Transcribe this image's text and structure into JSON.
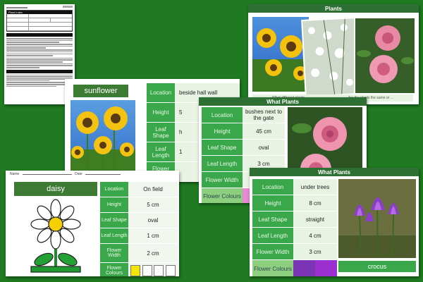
{
  "doc": {
    "heading": "Plant Index"
  },
  "sunflower_card": {
    "title": "sunflower",
    "rows": [
      {
        "label": "Location",
        "value": "beside hall wall"
      },
      {
        "label": "Height",
        "value": "5"
      },
      {
        "label": "Leaf Shape",
        "value": "h"
      },
      {
        "label": "Leaf Length",
        "value": "1"
      },
      {
        "label": "Flower Width",
        "value": ""
      }
    ],
    "colours": [
      "#f6c800",
      "#ffffff"
    ]
  },
  "plants_card": {
    "header": "Plants",
    "footer_left": "What different plants ...",
    "footer_right": "Are the plants the same or ..."
  },
  "what_plants_1": {
    "header": "What Plants",
    "rows": [
      {
        "label": "Location",
        "value": "bushes next to the gate"
      },
      {
        "label": "Height",
        "value": "45 cm"
      },
      {
        "label": "Leaf Shape",
        "value": "oval"
      },
      {
        "label": "Leaf Length",
        "value": "3 cm"
      },
      {
        "label": "Flower Width",
        "value": ""
      },
      {
        "label": "Flower Colours",
        "value": ""
      }
    ],
    "colour": "#e58ad3"
  },
  "daisy_card": {
    "meta_name": "Name",
    "meta_date": "Date",
    "title": "daisy",
    "rows": [
      {
        "label": "Location",
        "value": "On field"
      },
      {
        "label": "Height",
        "value": "5 cm"
      },
      {
        "label": "Leaf Shape",
        "value": "oval"
      },
      {
        "label": "Leaf Length",
        "value": "1 cm"
      },
      {
        "label": "Flower Width",
        "value": "2 cm"
      }
    ],
    "colours_label": "Flower Colours",
    "colours": [
      "#f5e600",
      "#ffffff",
      "#ffffff",
      "#ffffff"
    ]
  },
  "crocus_card": {
    "header": "What Plants",
    "rows": [
      {
        "label": "Location",
        "value": "under trees"
      },
      {
        "label": "Height",
        "value": "8 cm"
      },
      {
        "label": "Leaf Shape",
        "value": "straight"
      },
      {
        "label": "Leaf Length",
        "value": "4 cm"
      },
      {
        "label": "Flower Width",
        "value": "3 cm"
      }
    ],
    "colours_label": "Flower Colours",
    "colours": [
      "#7b35b4",
      "#9c2fd0"
    ],
    "name": "crocus"
  }
}
